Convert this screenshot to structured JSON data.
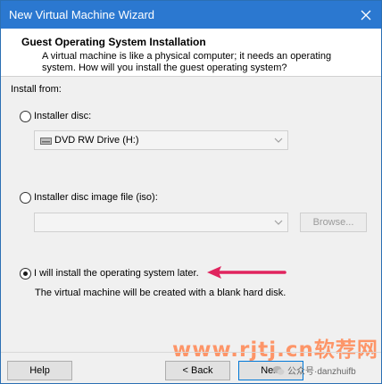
{
  "window": {
    "title": "New Virtual Machine Wizard"
  },
  "header": {
    "title": "Guest Operating System Installation",
    "description": "A virtual machine is like a physical computer; it needs an operating system. How will you install the guest operating system?"
  },
  "install_from_label": "Install from:",
  "options": {
    "installer_disc": {
      "label": "Installer disc:",
      "selected": false,
      "dropdown_value": "DVD RW Drive (H:)"
    },
    "iso_file": {
      "label": "Installer disc image file (iso):",
      "selected": false,
      "dropdown_value": "",
      "browse_label": "Browse..."
    },
    "install_later": {
      "label": "I will install the operating system later.",
      "selected": true,
      "description": "The virtual machine will be created with a blank hard disk."
    }
  },
  "footer": {
    "help_label": "Help",
    "back_label": "< Back",
    "next_label": "Next"
  },
  "watermark": {
    "site": "www.rjtj.cn软荐网",
    "account": "公众号·danzhuifb"
  },
  "colors": {
    "titlebar": "#2b78d0",
    "arrow": "#e0245e",
    "watermark": "#ff8c5a"
  }
}
